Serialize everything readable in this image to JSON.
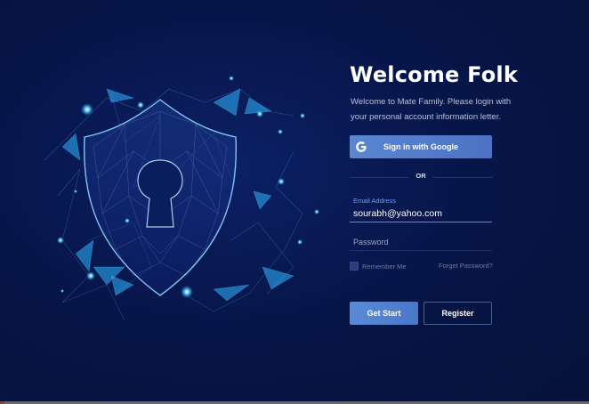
{
  "login": {
    "title": "Welcome Folk",
    "subtitle": "Welcome to Mate Family. Please login with your personal account information letter.",
    "google_button_label": "Sign in with Google",
    "divider_text": "OR",
    "email_label": "Email Address",
    "email_value": "sourabh@yahoo.com",
    "password_placeholder": "Password",
    "remember_label": "Remember Me",
    "forgot_label": "Forget Password?",
    "start_button_label": "Get Start",
    "register_button_label": "Register"
  },
  "icons": {
    "google": "google-g-icon",
    "illustration": "security-shield-keyhole-illustration"
  },
  "colors": {
    "background": "#061238",
    "primary_button": "#4d79c8",
    "email_accent": "#4d8cf0",
    "glow": "#3ec7ff"
  }
}
